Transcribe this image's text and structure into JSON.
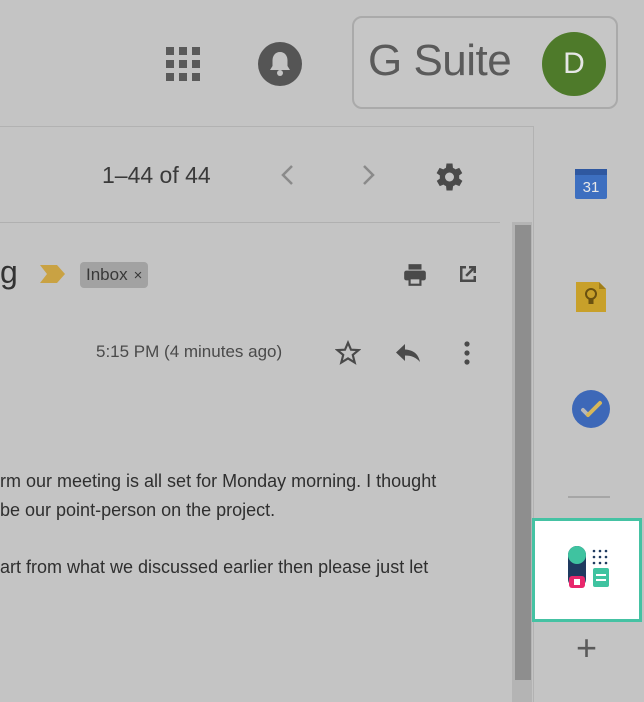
{
  "header": {
    "brand": "G Suite",
    "avatar_initial": "D"
  },
  "toolbar": {
    "pager_text": "1–44 of 44"
  },
  "message": {
    "subject_tail": "g",
    "label_chip": "Inbox",
    "chip_close": "×",
    "time": "5:15 PM (4 minutes ago)",
    "body_lines": [
      "rm our meeting is all set for Monday morning. I thought",
      "be our point-person on the project.",
      "art from what we discussed earlier then please just let"
    ]
  },
  "sidebar": {
    "calendar_day": "31",
    "add_label": "+"
  },
  "colors": {
    "avatar": "#4e7a2a",
    "addon_border": "#45c2a3",
    "calendar_blue": "#3d6fc0",
    "keep_yellow": "#c8a02a",
    "tasks_blue": "#3d68b8"
  }
}
